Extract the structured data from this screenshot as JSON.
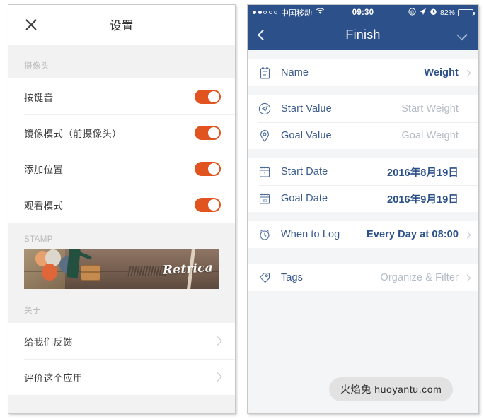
{
  "android": {
    "header": {
      "title": "设置",
      "close_icon": "close-icon"
    },
    "sections": [
      {
        "label": "摄像头",
        "rows": [
          {
            "label": "按键音",
            "control": "toggle",
            "on": true
          },
          {
            "label": "镜像模式（前摄像头）",
            "control": "toggle",
            "on": true
          },
          {
            "label": "添加位置",
            "control": "toggle",
            "on": true
          },
          {
            "label": "观看模式",
            "control": "toggle",
            "on": true
          }
        ]
      },
      {
        "label": "STAMP",
        "banner": {
          "brand": "Retrica"
        }
      },
      {
        "label": "关于",
        "rows": [
          {
            "label": "给我们反馈",
            "control": "chevron"
          },
          {
            "label": "评价这个应用",
            "control": "chevron"
          }
        ]
      }
    ]
  },
  "ios": {
    "status": {
      "carrier": "中国移动",
      "time": "09:30",
      "battery_text": "82%",
      "signal_filled": 2,
      "signal_total": 5,
      "icons": [
        "wifi-icon",
        "privacy-icon",
        "location-arrow-icon",
        "alarm-icon",
        "battery-icon"
      ]
    },
    "nav": {
      "title": "Finish",
      "back_icon": "back-chevron-icon",
      "confirm_icon": "checkmark-icon"
    },
    "groups": [
      {
        "rows": [
          {
            "icon": "notepad-icon",
            "label": "Name",
            "value": "Weight",
            "value_style": "strong",
            "chevron": true
          }
        ]
      },
      {
        "rows": [
          {
            "icon": "paper-plane-circle-icon",
            "label": "Start Value",
            "value": "Start Weight",
            "value_style": "muted",
            "chevron": false
          },
          {
            "icon": "map-pin-icon",
            "label": "Goal Value",
            "value": "Goal Weight",
            "value_style": "muted",
            "chevron": false
          }
        ]
      },
      {
        "rows": [
          {
            "icon": "calendar-start-icon",
            "label": "Start Date",
            "value": "2016年8月19日",
            "value_style": "strong",
            "chevron": false
          },
          {
            "icon": "calendar-goal-icon",
            "label": "Goal Date",
            "value": "2016年9月19日",
            "value_style": "strong",
            "chevron": false
          }
        ]
      },
      {
        "rows": [
          {
            "icon": "alarm-clock-icon",
            "label": "When to Log",
            "value": "Every Day at 08:00",
            "value_style": "strong",
            "chevron": true
          }
        ]
      },
      {
        "rows": [
          {
            "icon": "tag-icon",
            "label": "Tags",
            "value": "Organize & Filter",
            "value_style": "muted",
            "chevron": true
          }
        ]
      }
    ]
  },
  "watermark": {
    "text": "火焰兔 huoyantu.com"
  },
  "colors": {
    "accent_orange": "#e2541f",
    "ios_navy": "#2c5089",
    "ios_label": "#3a5a8c",
    "muted": "#b3bcc6"
  }
}
